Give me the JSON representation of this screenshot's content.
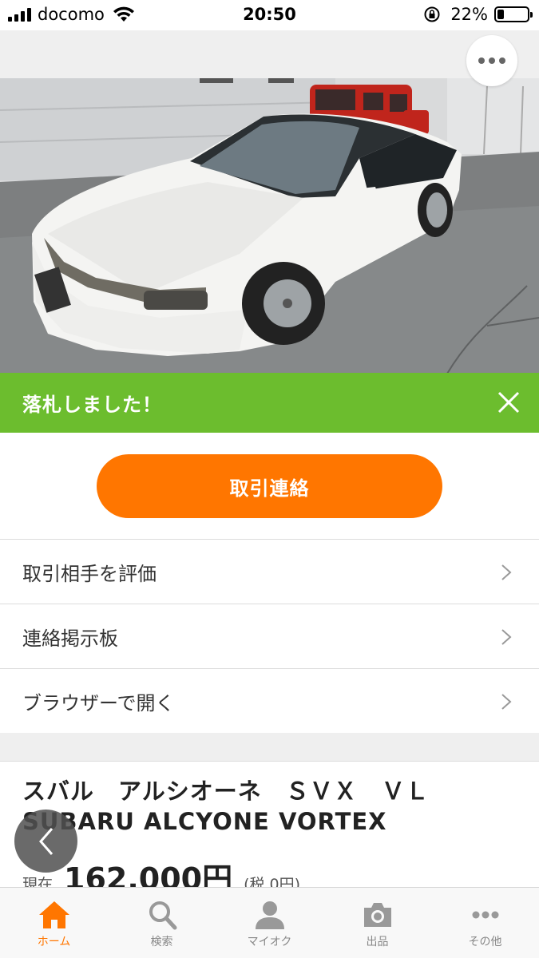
{
  "status_bar": {
    "carrier": "docomo",
    "time": "20:50",
    "battery_percent": "22%",
    "battery_level": 0.22
  },
  "photo": {
    "subject": "white-car-photo"
  },
  "banner": {
    "text": "落札しました！"
  },
  "actions": {
    "contact_label": "取引連絡"
  },
  "menu": {
    "items": [
      {
        "label": "取引相手を評価"
      },
      {
        "label": "連絡掲示板"
      },
      {
        "label": "ブラウザーで開く"
      }
    ]
  },
  "item": {
    "title": "スバル　アルシオーネ　ＳＶＸ　ＶＬ　SUBARU ALCYONE VORTEX",
    "price_label": "現在",
    "price": "162,000円",
    "tax": "(税 0円)"
  },
  "tabs": [
    {
      "label": "ホーム",
      "icon": "home-icon",
      "active": true
    },
    {
      "label": "検索",
      "icon": "search-icon",
      "active": false
    },
    {
      "label": "マイオク",
      "icon": "person-icon",
      "active": false
    },
    {
      "label": "出品",
      "icon": "camera-icon",
      "active": false
    },
    {
      "label": "その他",
      "icon": "more-dots-icon",
      "active": false
    }
  ],
  "colors": {
    "accent": "#ff7600",
    "banner_green": "#6cbd2e"
  }
}
